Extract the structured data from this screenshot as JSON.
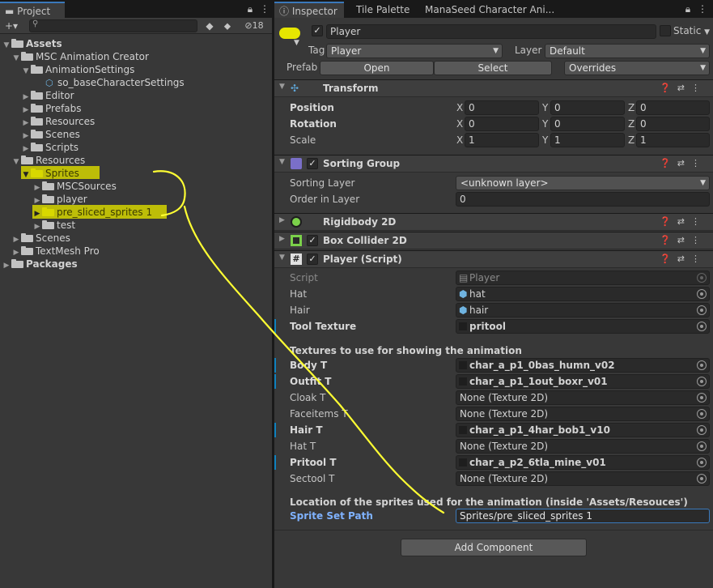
{
  "project": {
    "tab": "Project",
    "hidden_count": "18",
    "tree": [
      {
        "label": "Assets",
        "depth": 0,
        "open": true,
        "bold": true
      },
      {
        "label": "MSC Animation Creator",
        "depth": 1,
        "open": true
      },
      {
        "label": "AnimationSettings",
        "depth": 2,
        "open": true
      },
      {
        "label": "so_baseCharacterSettings",
        "depth": 3,
        "kind": "asset"
      },
      {
        "label": "Editor",
        "depth": 2
      },
      {
        "label": "Prefabs",
        "depth": 2
      },
      {
        "label": "Resources",
        "depth": 2
      },
      {
        "label": "Scenes",
        "depth": 2
      },
      {
        "label": "Scripts",
        "depth": 2
      },
      {
        "label": "Resources",
        "depth": 1,
        "open": true
      },
      {
        "label": "Sprites",
        "depth": 2,
        "open": true,
        "highlight": true
      },
      {
        "label": "MSCSources",
        "depth": 3
      },
      {
        "label": "player",
        "depth": 3
      },
      {
        "label": "pre_sliced_sprites 1",
        "depth": 3,
        "highlight": true
      },
      {
        "label": "test",
        "depth": 3
      },
      {
        "label": "Scenes",
        "depth": 1
      },
      {
        "label": "TextMesh Pro",
        "depth": 1
      },
      {
        "label": "Packages",
        "depth": 0,
        "bold": true
      }
    ]
  },
  "inspector": {
    "tabs": [
      "Inspector",
      "Tile Palette",
      "ManaSeed Character Ani..."
    ],
    "object_name": "Player",
    "static_label": "Static",
    "tag_label": "Tag",
    "tag_value": "Player",
    "layer_label": "Layer",
    "layer_value": "Default",
    "prefab_label": "Prefab",
    "prefab_open": "Open",
    "prefab_select": "Select",
    "prefab_overrides": "Overrides",
    "transform": {
      "title": "Transform",
      "position_label": "Position",
      "position": [
        "0",
        "0",
        "0"
      ],
      "rotation_label": "Rotation",
      "rotation": [
        "0",
        "0",
        "0"
      ],
      "scale_label": "Scale",
      "scale": [
        "1",
        "1",
        "1"
      ],
      "axes": [
        "X",
        "Y",
        "Z"
      ]
    },
    "sorting_group": {
      "title": "Sorting Group",
      "layer_label": "Sorting Layer",
      "layer_value": "<unknown layer>",
      "order_label": "Order in Layer",
      "order_value": "0"
    },
    "rigidbody": {
      "title": "Rigidbody 2D"
    },
    "box_collider": {
      "title": "Box Collider 2D"
    },
    "player_script": {
      "title": "Player (Script)",
      "script_label": "Script",
      "script_value": "Player",
      "hat_label": "Hat",
      "hat_value": "hat",
      "hair_label": "Hair",
      "hair_value": "hair",
      "tool_label": "Tool Texture",
      "tool_value": "pritool",
      "textures_header": "Textures to use for showing the animation",
      "textures": [
        {
          "label": "Body T",
          "value": "char_a_p1_0bas_humn_v02",
          "set": true
        },
        {
          "label": "Outfit T",
          "value": "char_a_p1_1out_boxr_v01",
          "set": true
        },
        {
          "label": "Cloak T",
          "value": "None (Texture 2D)",
          "set": false
        },
        {
          "label": "Faceitems T",
          "value": "None (Texture 2D)",
          "set": false
        },
        {
          "label": "Hair T",
          "value": "char_a_p1_4har_bob1_v10",
          "set": true
        },
        {
          "label": "Hat T",
          "value": "None (Texture 2D)",
          "set": false
        },
        {
          "label": "Pritool T",
          "value": "char_a_p2_6tla_mine_v01",
          "set": true
        },
        {
          "label": "Sectool T",
          "value": "None (Texture 2D)",
          "set": false
        }
      ],
      "location_header": "Location of the sprites used for the animation (inside 'Assets/Resouces')",
      "sprite_path_label": "Sprite Set Path",
      "sprite_path_value": "Sprites/pre_sliced_sprites 1"
    },
    "add_component": "Add Component"
  },
  "colors": {
    "highlight": "#e6e600",
    "accent": "#3a79bb",
    "annotation": "#ffff33"
  }
}
